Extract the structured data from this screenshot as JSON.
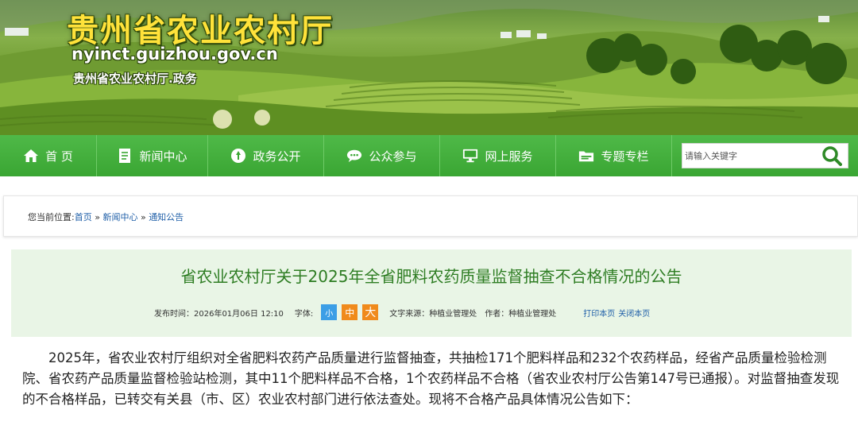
{
  "banner": {
    "title": "贵州省农业农村厅",
    "domain": "nyinct.guizhou.gov.cn",
    "subtitle": "贵州省农业农村厅.政务"
  },
  "nav": {
    "items": [
      {
        "label": "首 页",
        "icon": "home-icon"
      },
      {
        "label": "新闻中心",
        "icon": "document-icon"
      },
      {
        "label": "政务公开",
        "icon": "circle-arrow-icon"
      },
      {
        "label": "公众参与",
        "icon": "chat-icon"
      },
      {
        "label": "网上服务",
        "icon": "monitor-icon"
      },
      {
        "label": "专题专栏",
        "icon": "folder-icon"
      }
    ],
    "search_placeholder": "请输入关键字",
    "colors": {
      "nav_bg": "#3aa633",
      "accent": "#2e7d23"
    }
  },
  "breadcrumb": {
    "prefix": "您当前位置:",
    "items": [
      "首页",
      "新闻中心",
      "通知公告"
    ],
    "separator": "»"
  },
  "article": {
    "title": "省农业农村厅关于2025年全省肥料农药质量监督抽查不合格情况的公告",
    "publish_label": "发布时间：",
    "publish_time": "2026年01月06日 12:10",
    "font_label": "字体:",
    "font_sizes": [
      "小",
      "中",
      "大"
    ],
    "source_label": "文字来源：",
    "source": "种植业管理处",
    "author_label": "作者：",
    "author": "种植业管理处",
    "print_link": "打印本页",
    "close_link": "关闭本页",
    "body": "2025年，省农业农村厅组织对全省肥料农药产品质量进行监督抽查，共抽检171个肥料样品和232个农药样品，经省产品质量检验检测院、省农药产品质量监督检验站检测，其中11个肥料样品不合格，1个农药样品不合格（省农业农村厅公告第147号已通报）。对监督抽查发现的不合格样品，已转交有关县（市、区）农业农村部门进行依法查处。现将不合格产品具体情况公告如下："
  }
}
